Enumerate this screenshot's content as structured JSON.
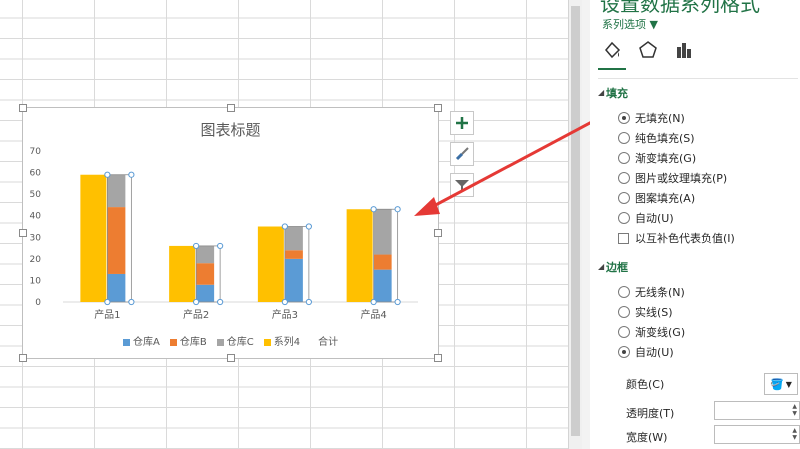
{
  "chart_data": {
    "type": "bar",
    "title": "图表标题",
    "categories": [
      "产品1",
      "产品2",
      "产品3",
      "产品4"
    ],
    "ylim": [
      0,
      70
    ],
    "yticks": [
      "0",
      "10",
      "20",
      "30",
      "40",
      "50",
      "60",
      "70"
    ],
    "series": [
      {
        "name": "仓库A",
        "values": [
          13,
          8,
          20,
          15
        ],
        "color": "#5b9bd5",
        "group": "stack"
      },
      {
        "name": "仓库B",
        "values": [
          31,
          10,
          4,
          7
        ],
        "color": "#ed7d31",
        "group": "stack"
      },
      {
        "name": "仓库C",
        "values": [
          15,
          8,
          11,
          21
        ],
        "color": "#a5a5a5",
        "group": "stack"
      },
      {
        "name": "系列4",
        "values": [
          59,
          26,
          35,
          43
        ],
        "color": "#ffc000",
        "group": "single"
      },
      {
        "name": "合计",
        "values": [
          59,
          26,
          35,
          43
        ],
        "color": "none",
        "group": "none-fill"
      }
    ],
    "legend_position": "bottom",
    "grid": false
  },
  "panel": {
    "title": "设置数据系列格式",
    "series_options": "系列选项 ▼",
    "fill_section": "填充",
    "fill_options": [
      "无填充(N)",
      "纯色填充(S)",
      "渐变填充(G)",
      "图片或纹理填充(P)",
      "图案填充(A)",
      "自动(U)"
    ],
    "invert_label": "以互补色代表负值(I)",
    "border_section": "边框",
    "border_options": [
      "无线条(N)",
      "实线(S)",
      "渐变线(G)",
      "自动(U)"
    ],
    "color_label": "颜色(C)",
    "transparency_label": "透明度(T)",
    "width_label": "宽度(W)"
  },
  "colors": {
    "accent": "#217346",
    "annotation": "#e53935"
  },
  "side_buttons": [
    "add-element-icon",
    "style-brush-icon",
    "filter-icon"
  ]
}
